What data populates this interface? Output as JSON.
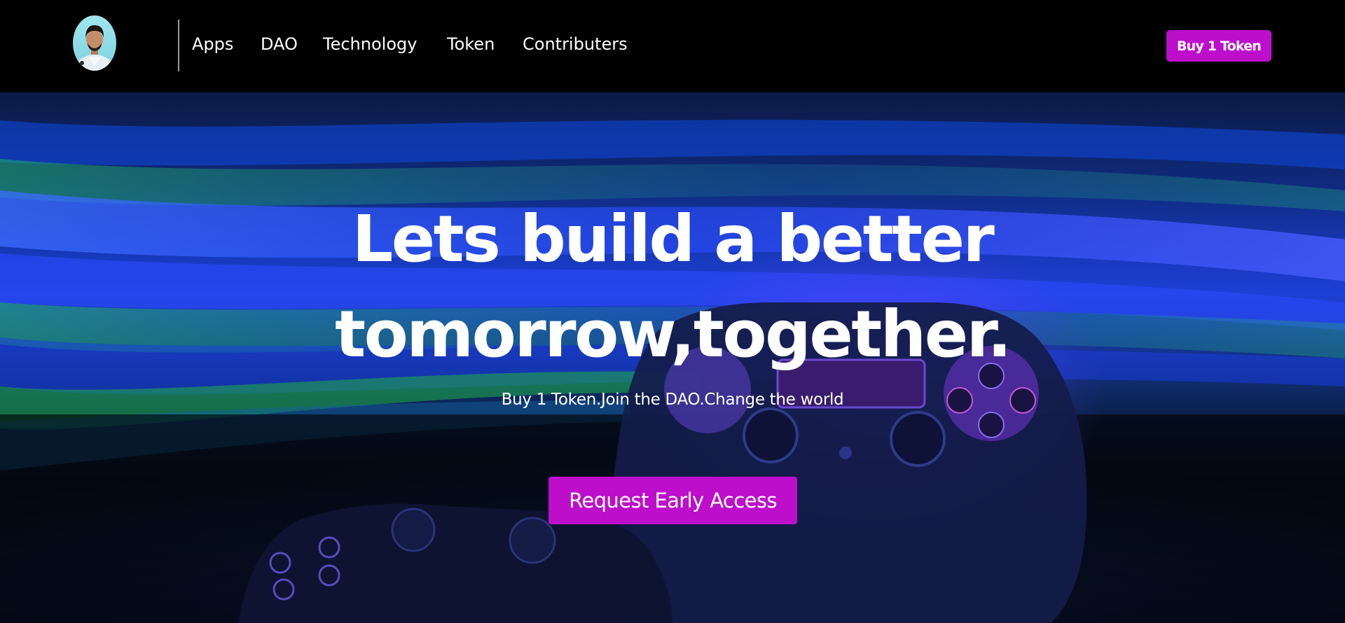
{
  "nav": {
    "links": [
      "Apps",
      "DAO",
      "Technology",
      "Token",
      "Contributers"
    ]
  },
  "header": {
    "buy_label": "Buy 1 Token"
  },
  "hero": {
    "title_line1": "Lets build a better",
    "title_line2": "tomorrow,together.",
    "subtitle": "Buy 1 Token.Join the DAO.Change the world",
    "cta_label": "Request Early Access"
  },
  "colors": {
    "accent": "#bd0fcb",
    "header_bg": "#000000",
    "hero_blue": "#1e3fd6",
    "hero_green": "#1f8f3a"
  },
  "icons": {
    "avatar": "user-avatar-photo",
    "hero_background": "game-controller-light-streaks"
  }
}
